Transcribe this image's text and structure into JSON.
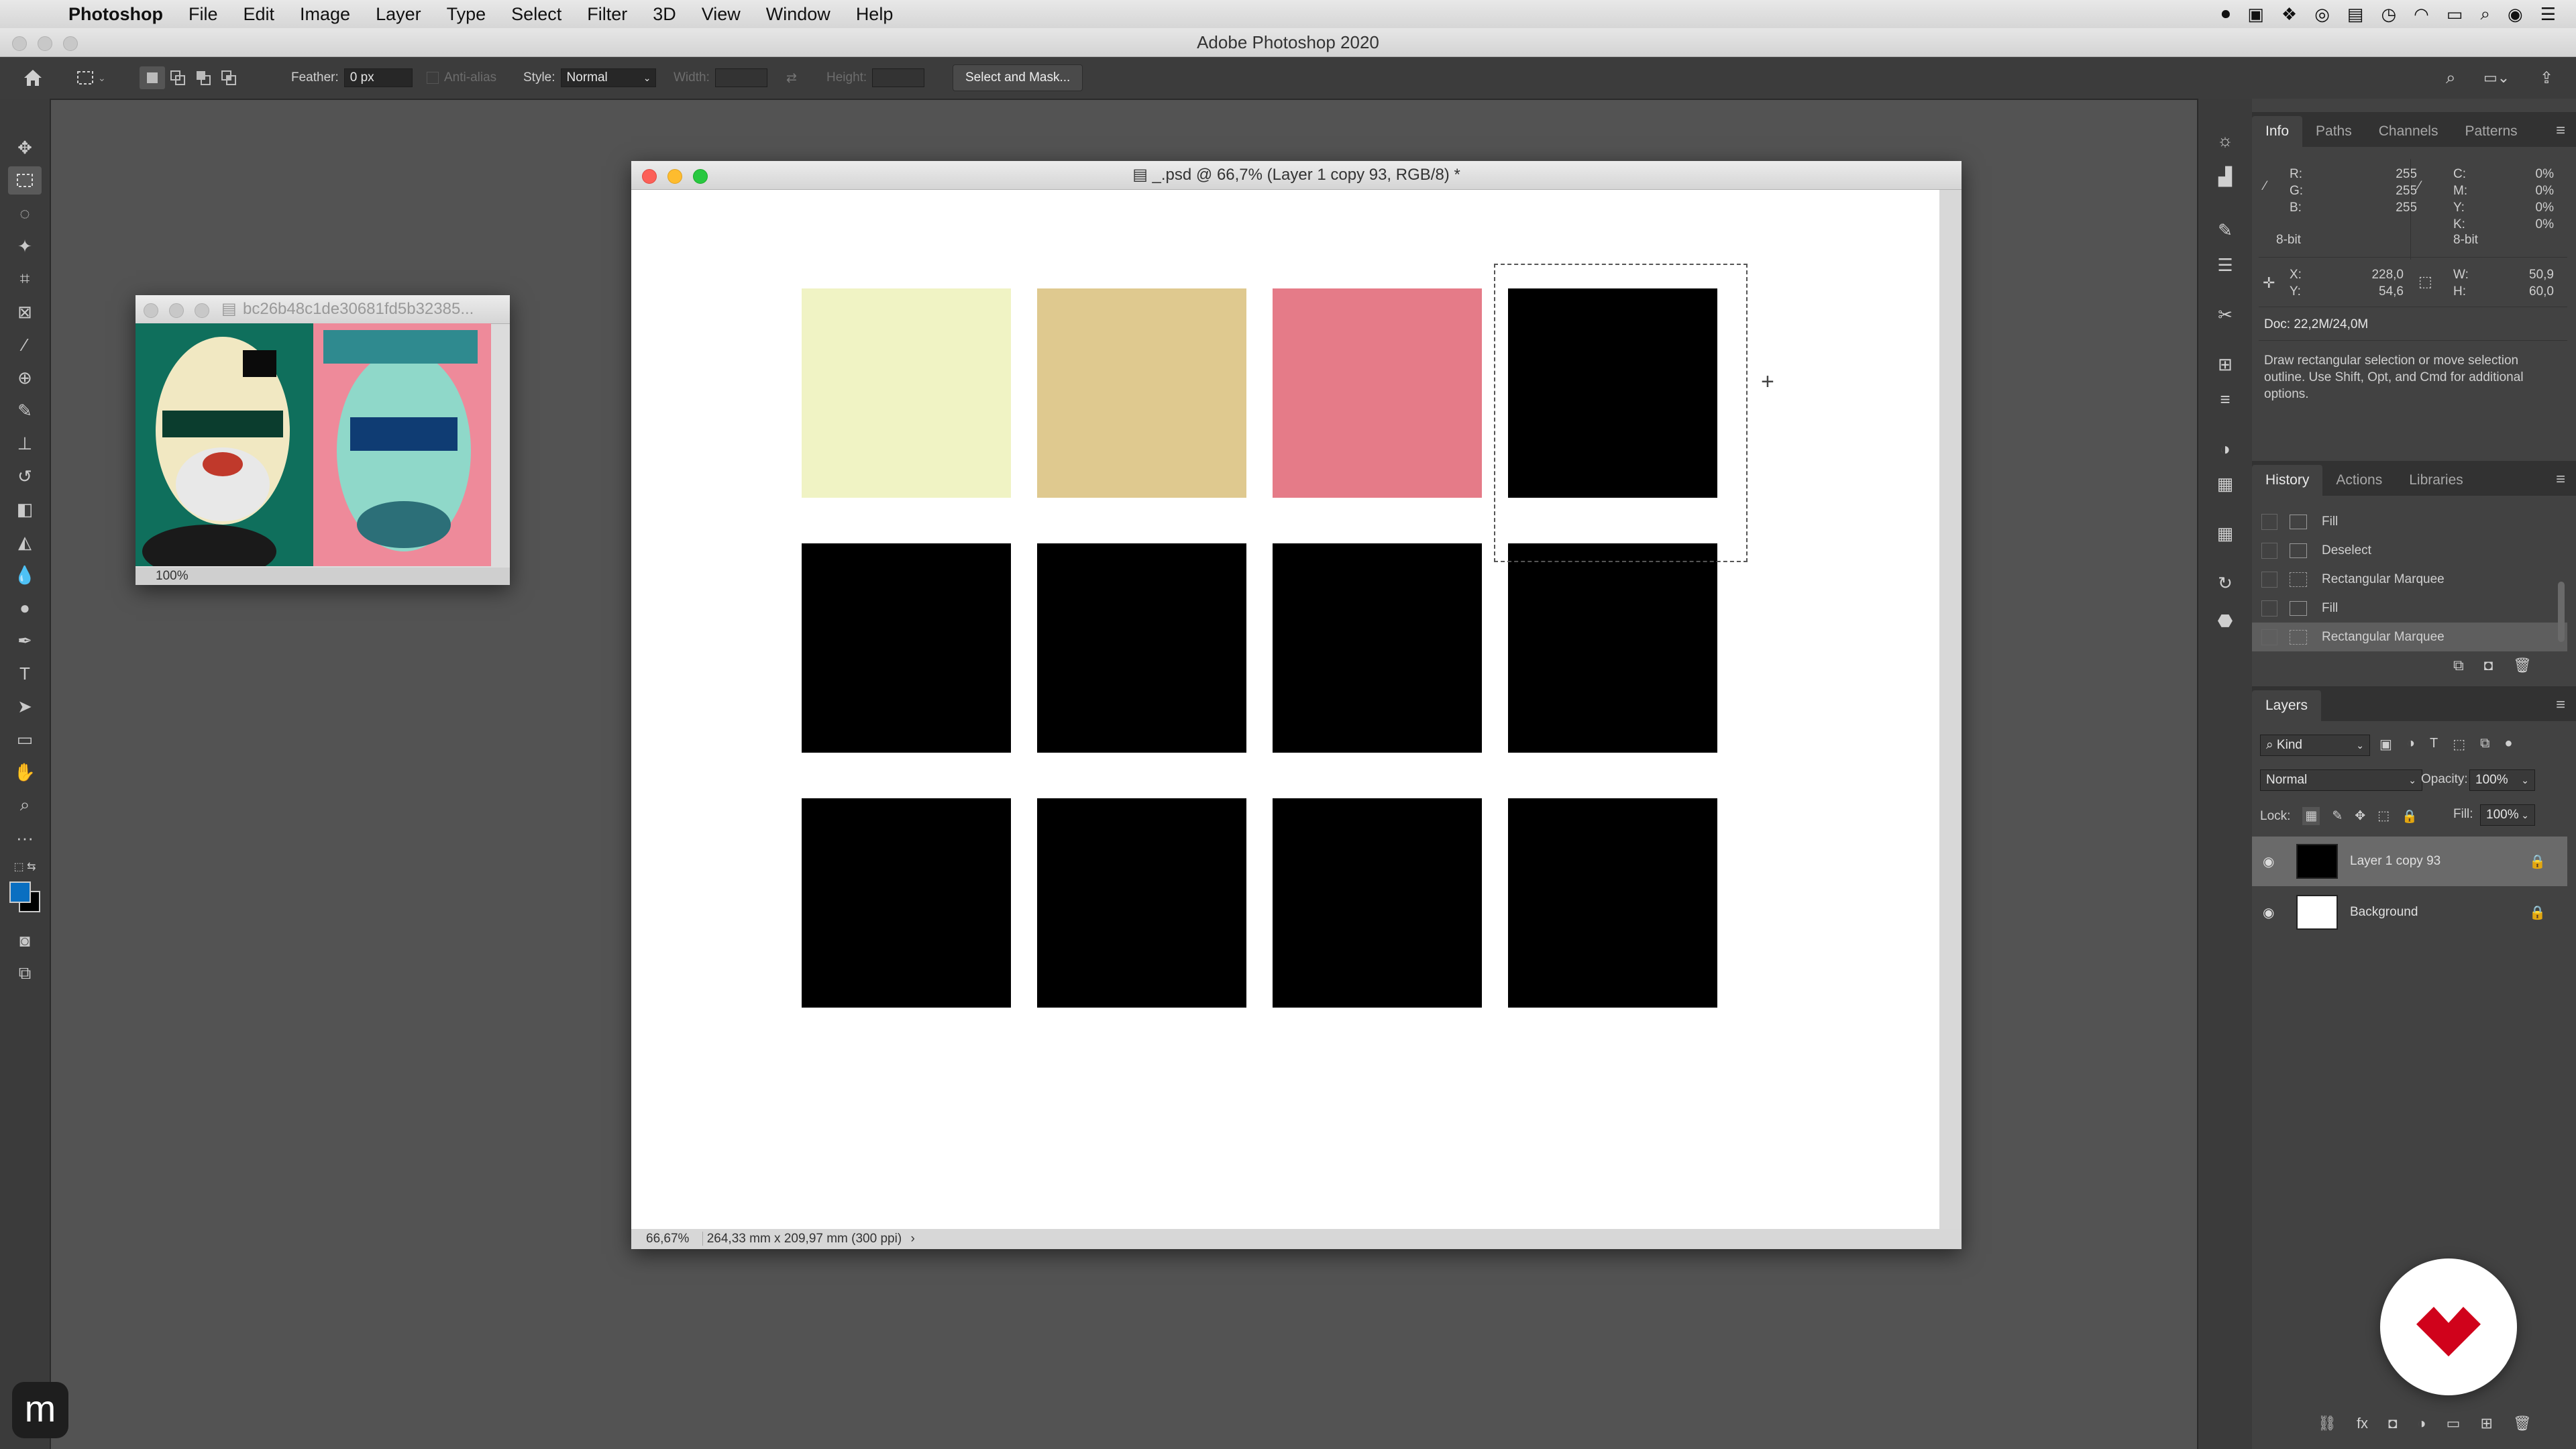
{
  "menubar": {
    "app": "Photoshop",
    "items": [
      "File",
      "Edit",
      "Image",
      "Layer",
      "Type",
      "Select",
      "Filter",
      "3D",
      "View",
      "Window",
      "Help"
    ]
  },
  "app_title": "Adobe Photoshop 2020",
  "options_bar": {
    "feather_label": "Feather:",
    "feather_value": "0 px",
    "antialias_label": "Anti-alias",
    "style_label": "Style:",
    "style_value": "Normal",
    "width_label": "Width:",
    "height_label": "Height:",
    "select_mask_button": "Select and Mask..."
  },
  "thumb_window": {
    "title": "bc26b48c1de30681fd5b32385...",
    "zoom": "100%"
  },
  "document": {
    "title": "_.psd @ 66,7% (Layer 1 copy 93, RGB/8) *",
    "zoom": "66,67%",
    "doc_size": "264,33 mm x 209,97 mm (300 ppi)",
    "swatch_colors": [
      [
        "#f0f3c4",
        "#dfc98f",
        "#e57b88",
        "#000000"
      ],
      [
        "#000000",
        "#000000",
        "#000000",
        "#000000"
      ],
      [
        "#000000",
        "#000000",
        "#000000",
        "#000000"
      ]
    ]
  },
  "info_panel": {
    "tabs": [
      "Info",
      "Paths",
      "Channels",
      "Patterns"
    ],
    "r_label": "R:",
    "r": "255",
    "g_label": "G:",
    "g": "255",
    "b_label": "B:",
    "b": "255",
    "bit_left": "8-bit",
    "c_label": "C:",
    "c": "0%",
    "m_label": "M:",
    "m": "0%",
    "y_label": "Y:",
    "y": "0%",
    "k_label": "K:",
    "k": "0%",
    "bit_right": "8-bit",
    "x_label": "X:",
    "x": "228,0",
    "y2_label": "Y:",
    "y2": "54,6",
    "w_label": "W:",
    "w": "50,9",
    "h_label": "H:",
    "h": "60,0",
    "doc": "Doc: 22,2M/24,0M",
    "hint": "Draw rectangular selection or move selection outline.  Use Shift, Opt, and Cmd for additional options."
  },
  "history_panel": {
    "tabs": [
      "History",
      "Actions",
      "Libraries"
    ],
    "items": [
      "Fill",
      "Deselect",
      "Rectangular Marquee",
      "Fill",
      "Rectangular Marquee"
    ]
  },
  "layers_panel": {
    "title": "Layers",
    "filter": "Kind",
    "blend_mode": "Normal",
    "opacity_label": "Opacity:",
    "opacity": "100%",
    "lock_label": "Lock:",
    "fill_label": "Fill:",
    "fill": "100%",
    "layers": [
      "Layer 1 copy 93",
      "Background"
    ]
  },
  "dock_badge": "m",
  "colors": {
    "foreground": "#0a6fc1",
    "background": "#000000",
    "logo_red": "#d0021b"
  }
}
